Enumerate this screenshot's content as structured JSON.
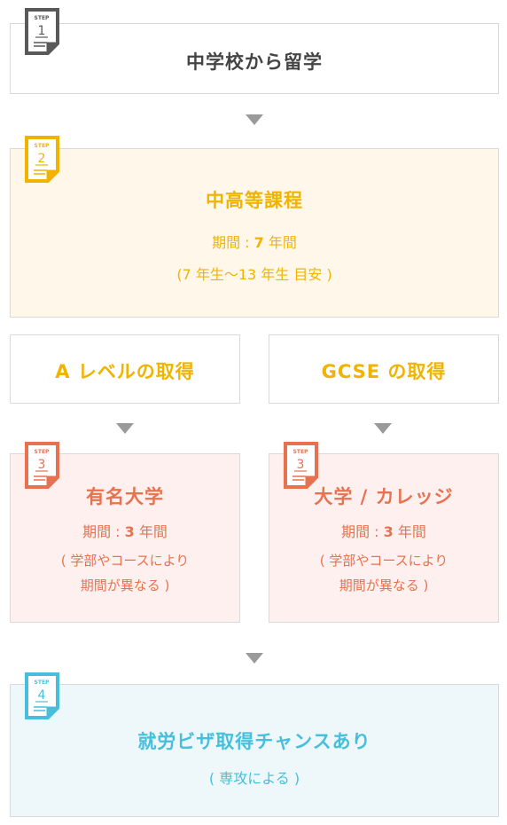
{
  "colors": {
    "gray": "#595959",
    "yellow": "#f0b400",
    "salmon": "#e8724f",
    "cyan": "#47bfdc",
    "arrow": "#9a9a9a"
  },
  "step_label": "STEP",
  "step1": {
    "number": "1",
    "title": "中学校から留学"
  },
  "step2": {
    "number": "2",
    "title": "中高等課程",
    "period_prefix": "期間 : ",
    "period_num": "7",
    "period_suffix": " 年間",
    "note": "(7 年生〜13 年生 目安 )"
  },
  "branch_left": {
    "title": "A レベルの取得"
  },
  "branch_right": {
    "title": "GCSE の取得"
  },
  "step3_left": {
    "number": "3",
    "title": "有名大学",
    "period_prefix": "期間 : ",
    "period_num": "3",
    "period_suffix": " 年間",
    "note_line1": "( 学部やコースにより",
    "note_line2": "期間が異なる )"
  },
  "step3_right": {
    "number": "3",
    "title": "大学 / カレッジ",
    "period_prefix": "期間 : ",
    "period_num": "3",
    "period_suffix": " 年間",
    "note_line1": "( 学部やコースにより",
    "note_line2": "期間が異なる )"
  },
  "step4": {
    "number": "4",
    "title": "就労ビザ取得チャンスあり",
    "note": "( 専攻による )"
  }
}
